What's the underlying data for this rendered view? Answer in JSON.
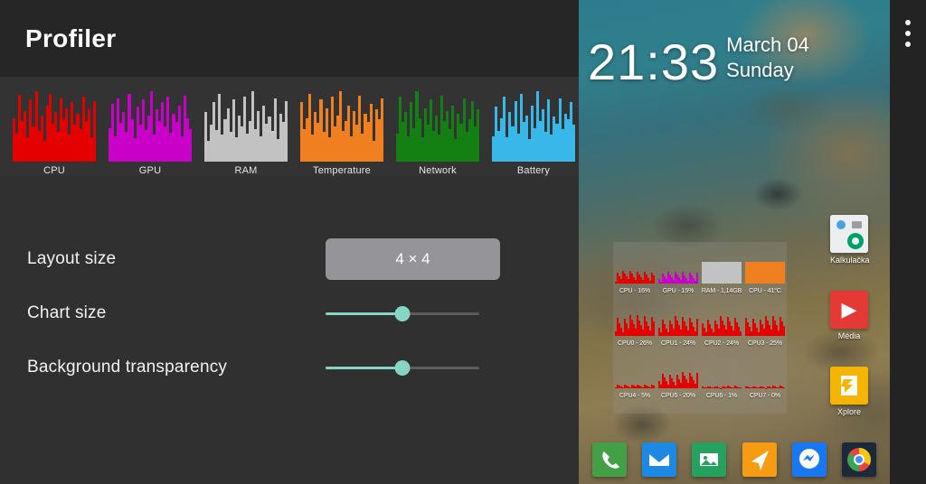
{
  "app": {
    "title": "Profiler",
    "charts": [
      {
        "label": "CPU",
        "color": "#e50000",
        "bars": [
          62,
          40,
          95,
          58,
          72,
          35,
          88,
          50,
          100,
          44,
          66,
          30,
          80,
          96,
          54,
          70,
          42,
          90,
          60,
          76,
          38,
          84,
          52,
          68,
          46,
          92,
          58,
          74,
          34,
          86
        ]
      },
      {
        "label": "GPU",
        "color": "#c800c8",
        "bars": [
          48,
          82,
          36,
          90,
          55,
          70,
          42,
          96,
          60,
          33,
          78,
          52,
          88,
          45,
          66,
          100,
          39,
          74,
          58,
          84,
          50,
          92,
          41,
          68,
          57,
          80,
          36,
          94,
          62,
          46
        ]
      },
      {
        "label": "RAM",
        "color": "#c2c2c2",
        "bars": [
          70,
          30,
          52,
          84,
          45,
          96,
          38,
          60,
          76,
          42,
          88,
          34,
          66,
          50,
          92,
          40,
          58,
          100,
          46,
          72,
          36,
          80,
          54,
          64,
          44,
          90,
          32,
          68,
          56,
          86
        ]
      },
      {
        "label": "Temperature",
        "color": "#f0801f",
        "bars": [
          84,
          46,
          62,
          96,
          38,
          70,
          55,
          88,
          42,
          76,
          34,
          92,
          50,
          66,
          100,
          44,
          58,
          80,
          36,
          72,
          52,
          94,
          40,
          68,
          56,
          82,
          30,
          74,
          60,
          90
        ]
      },
      {
        "label": "Network",
        "color": "#148014",
        "bars": [
          40,
          92,
          56,
          70,
          36,
          84,
          48,
          100,
          62,
          34,
          76,
          52,
          88,
          44,
          66,
          38,
          94,
          58,
          72,
          46,
          80,
          32,
          68,
          54,
          90,
          42,
          60,
          86,
          50,
          74
        ]
      },
      {
        "label": "Battery",
        "color": "#38b8e8",
        "bars": [
          36,
          78,
          44,
          62,
          92,
          34,
          70,
          50,
          86,
          40,
          96,
          56,
          66,
          32,
          80,
          48,
          100,
          58,
          74,
          42,
          88,
          38,
          64,
          54,
          90,
          46,
          68,
          60,
          84,
          52
        ]
      }
    ],
    "settings": [
      {
        "label": "Layout size",
        "type": "combo",
        "value": "4 × 4"
      },
      {
        "label": "Chart size",
        "type": "slider",
        "value": 50
      },
      {
        "label": "Background transparency",
        "type": "slider",
        "value": 50
      }
    ],
    "accent_color": "#86d4c3",
    "combo_color": "#949499"
  },
  "phone": {
    "clock": {
      "time": "21:33",
      "date": "March 04",
      "day": "Sunday"
    },
    "overflow_menu": "more-options",
    "overlay": {
      "cells": [
        {
          "label": "CPU - 16%",
          "color": "#e50000",
          "style": "graph",
          "level": 16
        },
        {
          "label": "GPU - 15%",
          "color": "#c800c8",
          "style": "graph",
          "level": 15
        },
        {
          "label": "RAM - 1,14GB",
          "color": "#c2c2c2",
          "style": "solid",
          "level": 55
        },
        {
          "label": "CPU - 41°C",
          "color": "#f0801f",
          "style": "solid",
          "level": 60
        },
        {
          "label": "CPU0 - 26%",
          "color": "#e50000",
          "style": "graph",
          "level": 26
        },
        {
          "label": "CPU1 - 24%",
          "color": "#e50000",
          "style": "graph",
          "level": 24
        },
        {
          "label": "CPU2 - 24%",
          "color": "#e50000",
          "style": "graph",
          "level": 24
        },
        {
          "label": "CPU3 - 25%",
          "color": "#e50000",
          "style": "graph",
          "level": 25
        },
        {
          "label": "CPU4 - 5%",
          "color": "#e50000",
          "style": "graph",
          "level": 5
        },
        {
          "label": "CPU5 - 20%",
          "color": "#e50000",
          "style": "graph",
          "level": 20
        },
        {
          "label": "CPU6 - 1%",
          "color": "#e50000",
          "style": "graph",
          "level": 1
        },
        {
          "label": "CPU7 - 0%",
          "color": "#e50000",
          "style": "graph",
          "level": 0
        }
      ]
    },
    "apps": [
      {
        "name": "Kalkulačka",
        "icon": "calculator-icon",
        "color": "#eceff1",
        "glyph": ""
      },
      {
        "name": "Média",
        "icon": "media-play-icon",
        "color": "#e53935",
        "glyph": "▶"
      },
      {
        "name": "Xplore",
        "icon": "file-manager-icon",
        "color": "#f5b401",
        "glyph": ""
      }
    ],
    "dock": [
      {
        "name": "Phone",
        "icon": "phone-icon",
        "color": "#43a047",
        "glyph": "✆"
      },
      {
        "name": "Email",
        "icon": "email-icon",
        "color": "#1e88e5",
        "glyph": "✉"
      },
      {
        "name": "Gallery",
        "icon": "gallery-icon",
        "color": "#27a160",
        "glyph": "🖼"
      },
      {
        "name": "Maps",
        "icon": "navigation-icon",
        "color": "#f59c12",
        "glyph": "➤"
      },
      {
        "name": "Messenger",
        "icon": "messenger-icon",
        "color": "#1877f2",
        "glyph": ""
      },
      {
        "name": "Chrome",
        "icon": "chrome-icon",
        "color": "#1b2a3a",
        "glyph": ""
      }
    ]
  }
}
